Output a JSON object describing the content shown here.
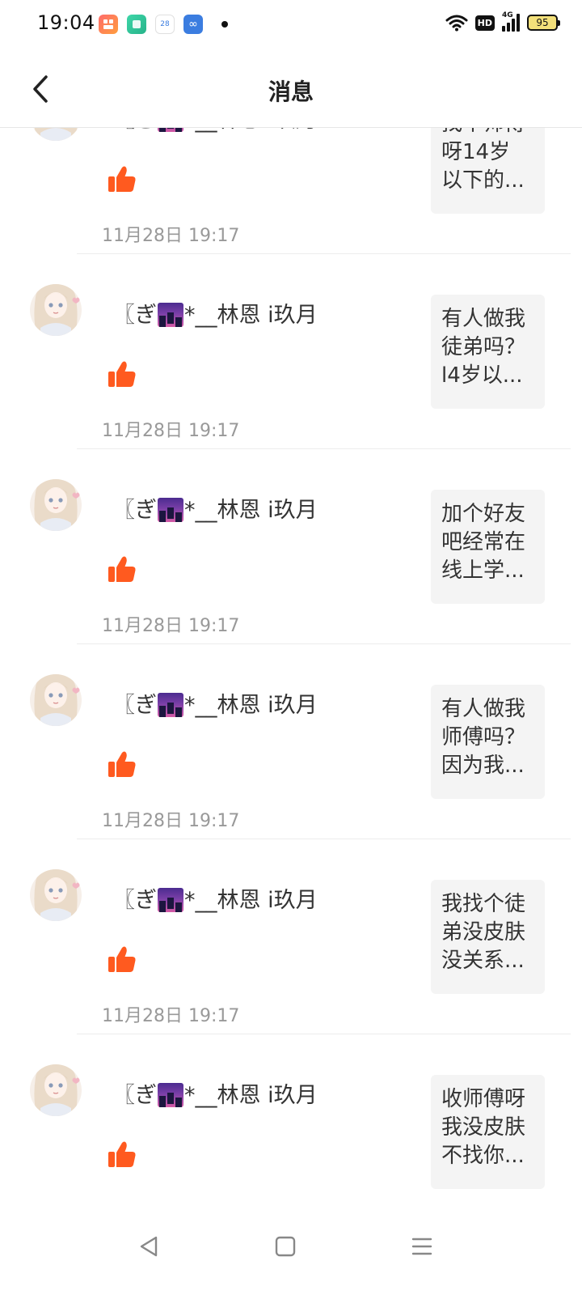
{
  "status_bar": {
    "time": "19:04",
    "app_icons": [
      "video-app-icon",
      "notes-app-icon",
      "calendar-app-icon",
      "infinity-app-icon"
    ],
    "calendar_day": "28",
    "hd_label": "HD",
    "network_label": "4G",
    "battery_level": "95"
  },
  "header": {
    "title": "消息",
    "back_icon": "chevron-left-icon"
  },
  "colors": {
    "like": "#ff5a1f",
    "preview_bg": "#f4f4f4",
    "time_text": "#999999"
  },
  "messages": [
    {
      "name_prefix": "〖ぎ",
      "name_suffix": "*__林恩 i玖月",
      "like_icon": "thumbs-up-icon",
      "time": "11月28日 19:17",
      "preview_lines": [
        "找个师傅",
        "呀14岁",
        "以下的..."
      ]
    },
    {
      "name_prefix": "〖ぎ",
      "name_suffix": "*__林恩 i玖月",
      "like_icon": "thumbs-up-icon",
      "time": "11月28日 19:17",
      "preview_lines": [
        "有人做我",
        "徒弟吗？",
        "l4岁以..."
      ]
    },
    {
      "name_prefix": "〖ぎ",
      "name_suffix": "*__林恩 i玖月",
      "like_icon": "thumbs-up-icon",
      "time": "11月28日 19:17",
      "preview_lines": [
        "加个好友",
        "吧经常在",
        "线上学..."
      ]
    },
    {
      "name_prefix": "〖ぎ",
      "name_suffix": "*__林恩 i玖月",
      "like_icon": "thumbs-up-icon",
      "time": "11月28日 19:17",
      "preview_lines": [
        "有人做我",
        "师傅吗？",
        "因为我..."
      ]
    },
    {
      "name_prefix": "〖ぎ",
      "name_suffix": "*__林恩 i玖月",
      "like_icon": "thumbs-up-icon",
      "time": "11月28日 19:17",
      "preview_lines": [
        "我找个徒",
        "弟没皮肤",
        "没关系..."
      ]
    },
    {
      "name_prefix": "〖ぎ",
      "name_suffix": "*__林恩 i玖月",
      "like_icon": "thumbs-up-icon",
      "time": "",
      "preview_lines": [
        "收师傅呀",
        "我没皮肤",
        "不找你..."
      ]
    }
  ],
  "nav_bar": {
    "back": "triangle-back-icon",
    "home": "square-home-icon",
    "menu": "menu-lines-icon"
  }
}
